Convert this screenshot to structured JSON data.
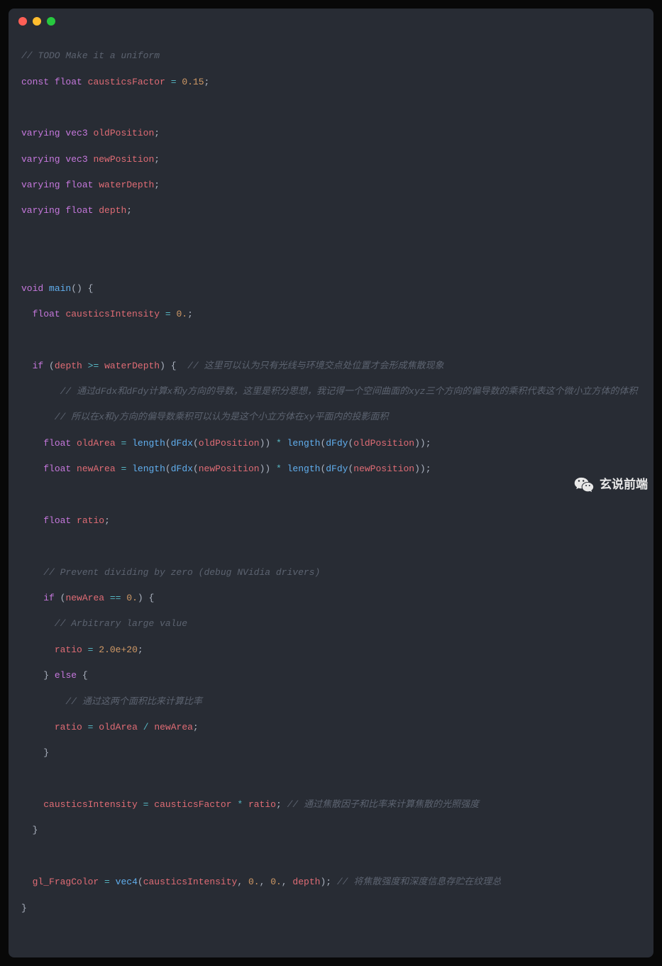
{
  "code": {
    "c1": "// TODO Make it a uniform",
    "l2": {
      "kw1": "const",
      "t": "float",
      "id": "causticsFactor",
      "eq": "=",
      "num": "0.15",
      "sc": ";"
    },
    "l4": {
      "kw": "varying",
      "t": "vec3",
      "id": "oldPosition",
      "sc": ";"
    },
    "l5": {
      "kw": "varying",
      "t": "vec3",
      "id": "newPosition",
      "sc": ";"
    },
    "l6": {
      "kw": "varying",
      "t": "float",
      "id": "waterDepth",
      "sc": ";"
    },
    "l7": {
      "kw": "varying",
      "t": "float",
      "id": "depth",
      "sc": ";"
    },
    "l9": {
      "kw": "void",
      "fn": "main",
      "par": "()",
      "ob": "{"
    },
    "l10": {
      "t": "float",
      "id": "causticsIntensity",
      "eq": "=",
      "num": "0.",
      "sc": ";"
    },
    "l12": {
      "kw": "if",
      "op": "(",
      "id": "depth",
      "cmp": ">=",
      "id2": "waterDepth",
      "cp": ")",
      "ob": "{",
      "c": "  // 这里可以认为只有光线与环境交点处位置才会形成焦散现象"
    },
    "c13": "       // 通过dFdx和dFdy计算x和y方向的导数，这里是积分思想，我记得一个空间曲面的xyz三个方向的偏导数的乘积代表这个微小立方体的体积",
    "c14": "      // 所以在x和y方向的偏导数乘积可以认为是这个小立方体在xy平面内的投影面积",
    "l15": {
      "t": "float",
      "id": "oldArea",
      "eq": "=",
      "fn": "length",
      "op": "(",
      "fn2": "dFdx",
      "op2": "(",
      "id2": "oldPosition",
      "cp": "))",
      "mul": "*",
      "fn3": "length",
      "op3": "(",
      "fn4": "dFdy",
      "op4": "(",
      "id3": "oldPosition",
      "cp2": "));"
    },
    "l16": {
      "t": "float",
      "id": "newArea",
      "eq": "=",
      "fn": "length",
      "op": "(",
      "fn2": "dFdx",
      "op2": "(",
      "id2": "newPosition",
      "cp": "))",
      "mul": "*",
      "fn3": "length",
      "op3": "(",
      "fn4": "dFdy",
      "op4": "(",
      "id3": "newPosition",
      "cp2": "));"
    },
    "l18": {
      "t": "float",
      "id": "ratio",
      "sc": ";"
    },
    "c20": "    // Prevent dividing by zero (debug NVidia drivers)",
    "l21": {
      "kw": "if",
      "op": "(",
      "id": "newArea",
      "cmp": "==",
      "num": "0.",
      "cp": ")",
      "ob": "{"
    },
    "c22": "      // Arbitrary large value",
    "l23": {
      "id": "ratio",
      "eq": "=",
      "num": "2.0e+20",
      "sc": ";"
    },
    "l24": {
      "cb": "}",
      "kw": "else",
      "ob": "{"
    },
    "c25": "        // 通过这两个面积比来计算比率",
    "l26": {
      "id": "ratio",
      "eq": "=",
      "id2": "oldArea",
      "op": "/",
      "id3": "newArea",
      "sc": ";"
    },
    "l27": {
      "cb": "}"
    },
    "l29": {
      "id": "causticsIntensity",
      "eq": "=",
      "id2": "causticsFactor",
      "op": "*",
      "id3": "ratio",
      "sc": ";",
      "c": " // 通过焦散因子和比率来计算焦散的光照强度"
    },
    "l30": {
      "cb": "}"
    },
    "l32": {
      "id": "gl_FragColor",
      "eq": "=",
      "fn": "vec4",
      "op": "(",
      "id2": "causticsIntensity",
      "cm": ",",
      "num1": "0.",
      "cm2": ",",
      "num2": "0.",
      "cm3": ",",
      "id3": "depth",
      "cp": ");",
      "c": " // 将焦散强度和深度信息存贮在纹理总"
    },
    "l33": {
      "cb": "}"
    }
  },
  "watermark": {
    "text": "玄说前端"
  },
  "colors": {
    "bg": "#282c34",
    "red": "#ff5f56",
    "yellow": "#ffbd2e",
    "green": "#27c93f"
  }
}
